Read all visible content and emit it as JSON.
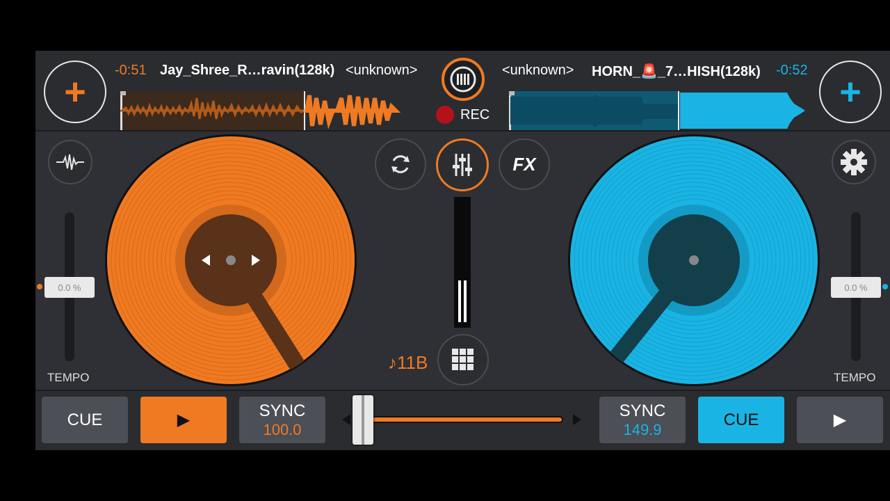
{
  "deck_left": {
    "time_remaining": "-0:51",
    "track_title": "Jay_Shree_R…ravin(128k)",
    "artist": "<unknown>",
    "tempo_value": "0.0 %",
    "tempo_label": "TEMPO",
    "cue_label": "CUE",
    "play_icon": "▶",
    "sync_label": "SYNC",
    "bpm": "100.0",
    "color": "#f07a22"
  },
  "deck_right": {
    "time_remaining": "-0:52",
    "track_title": "HORN_🚨_7…HISH(128k)",
    "artist": "<unknown>",
    "tempo_value": "0.0 %",
    "tempo_label": "TEMPO",
    "cue_label": "CUE",
    "play_icon": "▶",
    "sync_label": "SYNC",
    "bpm": "149.9",
    "color": "#1ab4e4"
  },
  "center": {
    "rec_label": "REC",
    "fx_label": "FX",
    "key_label": "♪11B",
    "crossfader_position": 0.04
  },
  "icons": [
    "add-track-icon",
    "record-menu-icon",
    "sync-loop-icon",
    "mixer-icon",
    "fx-icon",
    "sampler-grid-icon",
    "waveform-icon",
    "settings-gear-icon",
    "play-icon"
  ]
}
